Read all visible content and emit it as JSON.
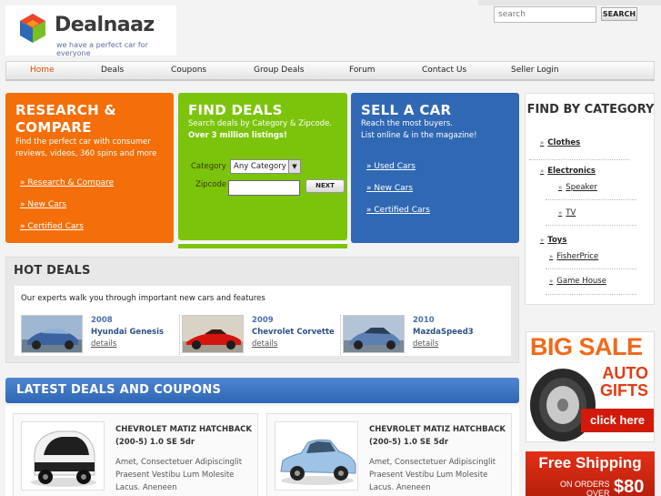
{
  "brand": {
    "name": "Dealnaaz",
    "tagline": "we have a perfect car for everyone"
  },
  "search": {
    "placeholder": "search",
    "button": "SEARCH"
  },
  "nav": [
    {
      "label": "Home"
    },
    {
      "label": "Deals"
    },
    {
      "label": "Coupons"
    },
    {
      "label": "Group Deals"
    },
    {
      "label": "Forum"
    },
    {
      "label": "Contact Us"
    },
    {
      "label": "Seller Login"
    }
  ],
  "research": {
    "title": "RESEARCH & COMPARE",
    "text": "Find the perfect car with consumer reviews, videos, 360 spins and more",
    "links": [
      "» Research & Compare",
      "» New Cars",
      "» Certified Cars"
    ]
  },
  "find": {
    "title": "FIND DEALS",
    "text": "Search deals by Category & Zipcode.",
    "highlight": "Over 3 million listings!",
    "category_label": "Category",
    "category_value": "Any Category",
    "zipcode_label": "Zipcode",
    "button": "NEXT"
  },
  "sell": {
    "title": "SELL A CAR",
    "text1": "Reach the most buyers.",
    "text2": "List online & in the magazine!",
    "links": [
      "» Used Cars",
      "» New Cars",
      "» Certified Cars"
    ]
  },
  "hot": {
    "title": "HOT DEALS",
    "intro": "Our experts walk you through important new cars and features",
    "cars": [
      {
        "year": "2008",
        "model": "Hyundai Genesis",
        "details": "details"
      },
      {
        "year": "2009",
        "model": "Chevrolet Corvette",
        "details": "details"
      },
      {
        "year": "2010",
        "model": "MazdaSpeed3",
        "details": "details"
      }
    ]
  },
  "latest": {
    "title": "LATEST DEALS AND COUPONS",
    "items": [
      {
        "title": "CHEVROLET MATIZ HATCHBACK (200-5) 1.0 SE 5dr",
        "desc": "Amet, Consectetuer Adipiscinglit Praesent Vestibu Lum Molesite Lacus. Aneneen"
      },
      {
        "title": "CHEVROLET MATIZ HATCHBACK (200-5) 1.0 SE 5dr",
        "desc": "Amet, Consectetuer Adipiscinglit Praesent Vestibu Lum Molesite Lacus. Aneneen"
      }
    ]
  },
  "category": {
    "title": "FIND BY CATEGORY",
    "items": [
      "Clothes",
      "Electronics",
      "Speaker",
      "TV",
      "Toys",
      "FisherPrice",
      "Game House"
    ]
  },
  "ads": {
    "big_sale": "BIG SALE",
    "auto_gifts": [
      "AUTO",
      "GIFTS"
    ],
    "click": "click here",
    "free_shipping": "Free Shipping",
    "orders": "ON ORDERS",
    "over": "OVER",
    "amount": "$80"
  },
  "colors": {
    "research": "#f46f09",
    "find": "#7cc40b",
    "sell": "#3068b4",
    "nav_active": "#e64b00",
    "latest": "#2f66b5"
  }
}
